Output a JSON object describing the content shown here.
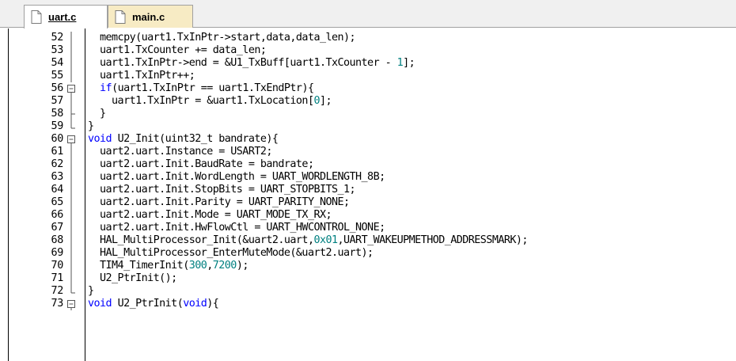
{
  "tabs": [
    {
      "label": "uart.c",
      "active": true,
      "icon": "file-icon"
    },
    {
      "label": "main.c",
      "active": false,
      "icon": "file-icon"
    }
  ],
  "colors": {
    "keyword": "#0000ff",
    "number": "#008080",
    "text": "#000000",
    "inactive_tab": "#f7ebc4"
  },
  "lines": [
    {
      "n": "52",
      "fold": "line",
      "code": [
        {
          "t": "  memcpy(uart1.TxInPtr->start,data,data_len);"
        }
      ]
    },
    {
      "n": "53",
      "fold": "line",
      "code": [
        {
          "t": "  uart1.TxCounter += data_len;"
        }
      ]
    },
    {
      "n": "54",
      "fold": "line",
      "code": [
        {
          "t": "  uart1.TxInPtr->end = &U1_TxBuff[uart1.TxCounter - "
        },
        {
          "t": "1",
          "c": "num"
        },
        {
          "t": "];"
        }
      ]
    },
    {
      "n": "55",
      "fold": "line",
      "code": [
        {
          "t": "  uart1.TxInPtr++;"
        }
      ]
    },
    {
      "n": "56",
      "fold": "box",
      "code": [
        {
          "t": "  "
        },
        {
          "t": "if",
          "c": "kw"
        },
        {
          "t": "(uart1.TxInPtr == uart1.TxEndPtr){"
        }
      ]
    },
    {
      "n": "57",
      "fold": "line",
      "code": [
        {
          "t": "    uart1.TxInPtr = &uart1.TxLocation["
        },
        {
          "t": "0",
          "c": "num"
        },
        {
          "t": "];"
        }
      ]
    },
    {
      "n": "58",
      "fold": "tee",
      "code": [
        {
          "t": "  }"
        }
      ]
    },
    {
      "n": "59",
      "fold": "end",
      "code": [
        {
          "t": "}"
        }
      ]
    },
    {
      "n": "60",
      "fold": "box",
      "code": [
        {
          "t": "void",
          "c": "kw"
        },
        {
          "t": " U2_Init(uint32_t bandrate){"
        }
      ]
    },
    {
      "n": "61",
      "fold": "line",
      "code": [
        {
          "t": "  uart2.uart.Instance = USART2;"
        }
      ]
    },
    {
      "n": "62",
      "fold": "line",
      "code": [
        {
          "t": "  uart2.uart.Init.BaudRate = bandrate;"
        }
      ]
    },
    {
      "n": "63",
      "fold": "line",
      "code": [
        {
          "t": "  uart2.uart.Init.WordLength = UART_WORDLENGTH_8B;"
        }
      ]
    },
    {
      "n": "64",
      "fold": "line",
      "code": [
        {
          "t": "  uart2.uart.Init.StopBits = UART_STOPBITS_1;"
        }
      ]
    },
    {
      "n": "65",
      "fold": "line",
      "code": [
        {
          "t": "  uart2.uart.Init.Parity = UART_PARITY_NONE;"
        }
      ]
    },
    {
      "n": "66",
      "fold": "line",
      "code": [
        {
          "t": "  uart2.uart.Init.Mode = UART_MODE_TX_RX;"
        }
      ]
    },
    {
      "n": "67",
      "fold": "line",
      "code": [
        {
          "t": "  uart2.uart.Init.HwFlowCtl = UART_HWCONTROL_NONE;"
        }
      ]
    },
    {
      "n": "68",
      "fold": "line",
      "code": [
        {
          "t": "  HAL_MultiProcessor_Init(&uart2.uart,"
        },
        {
          "t": "0x01",
          "c": "num"
        },
        {
          "t": ",UART_WAKEUPMETHOD_ADDRESSMARK);"
        }
      ]
    },
    {
      "n": "69",
      "fold": "line",
      "code": [
        {
          "t": "  HAL_MultiProcessor_EnterMuteMode(&uart2.uart);"
        }
      ]
    },
    {
      "n": "70",
      "fold": "line",
      "code": [
        {
          "t": "  TIM4_TimerInit("
        },
        {
          "t": "300",
          "c": "num"
        },
        {
          "t": ","
        },
        {
          "t": "7200",
          "c": "num"
        },
        {
          "t": ");"
        }
      ]
    },
    {
      "n": "71",
      "fold": "line",
      "code": [
        {
          "t": "  U2_PtrInit();"
        }
      ]
    },
    {
      "n": "72",
      "fold": "end",
      "code": [
        {
          "t": "}"
        }
      ]
    },
    {
      "n": "73",
      "fold": "box",
      "code": [
        {
          "t": "void",
          "c": "kw"
        },
        {
          "t": " U2_PtrInit("
        },
        {
          "t": "void",
          "c": "kw"
        },
        {
          "t": "){"
        }
      ]
    }
  ]
}
